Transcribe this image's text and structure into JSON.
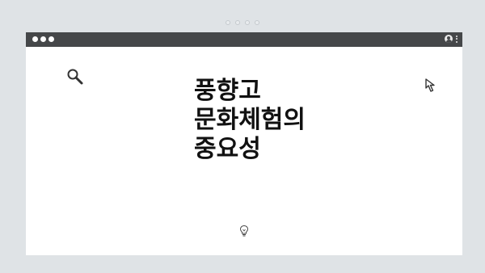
{
  "window": {
    "title_bar_color": "#454749",
    "background": "#ffffff"
  },
  "page_background": "#dfe3e6",
  "top_indicator_dots": 4,
  "icons": {
    "user": "user-icon",
    "menu": "kebab-menu-icon",
    "search": "magnifier-icon",
    "cursor": "cursor-arrow-icon",
    "idea": "lightbulb-icon"
  },
  "main": {
    "headline": "풍향고\n문화체험의\n중요성"
  }
}
